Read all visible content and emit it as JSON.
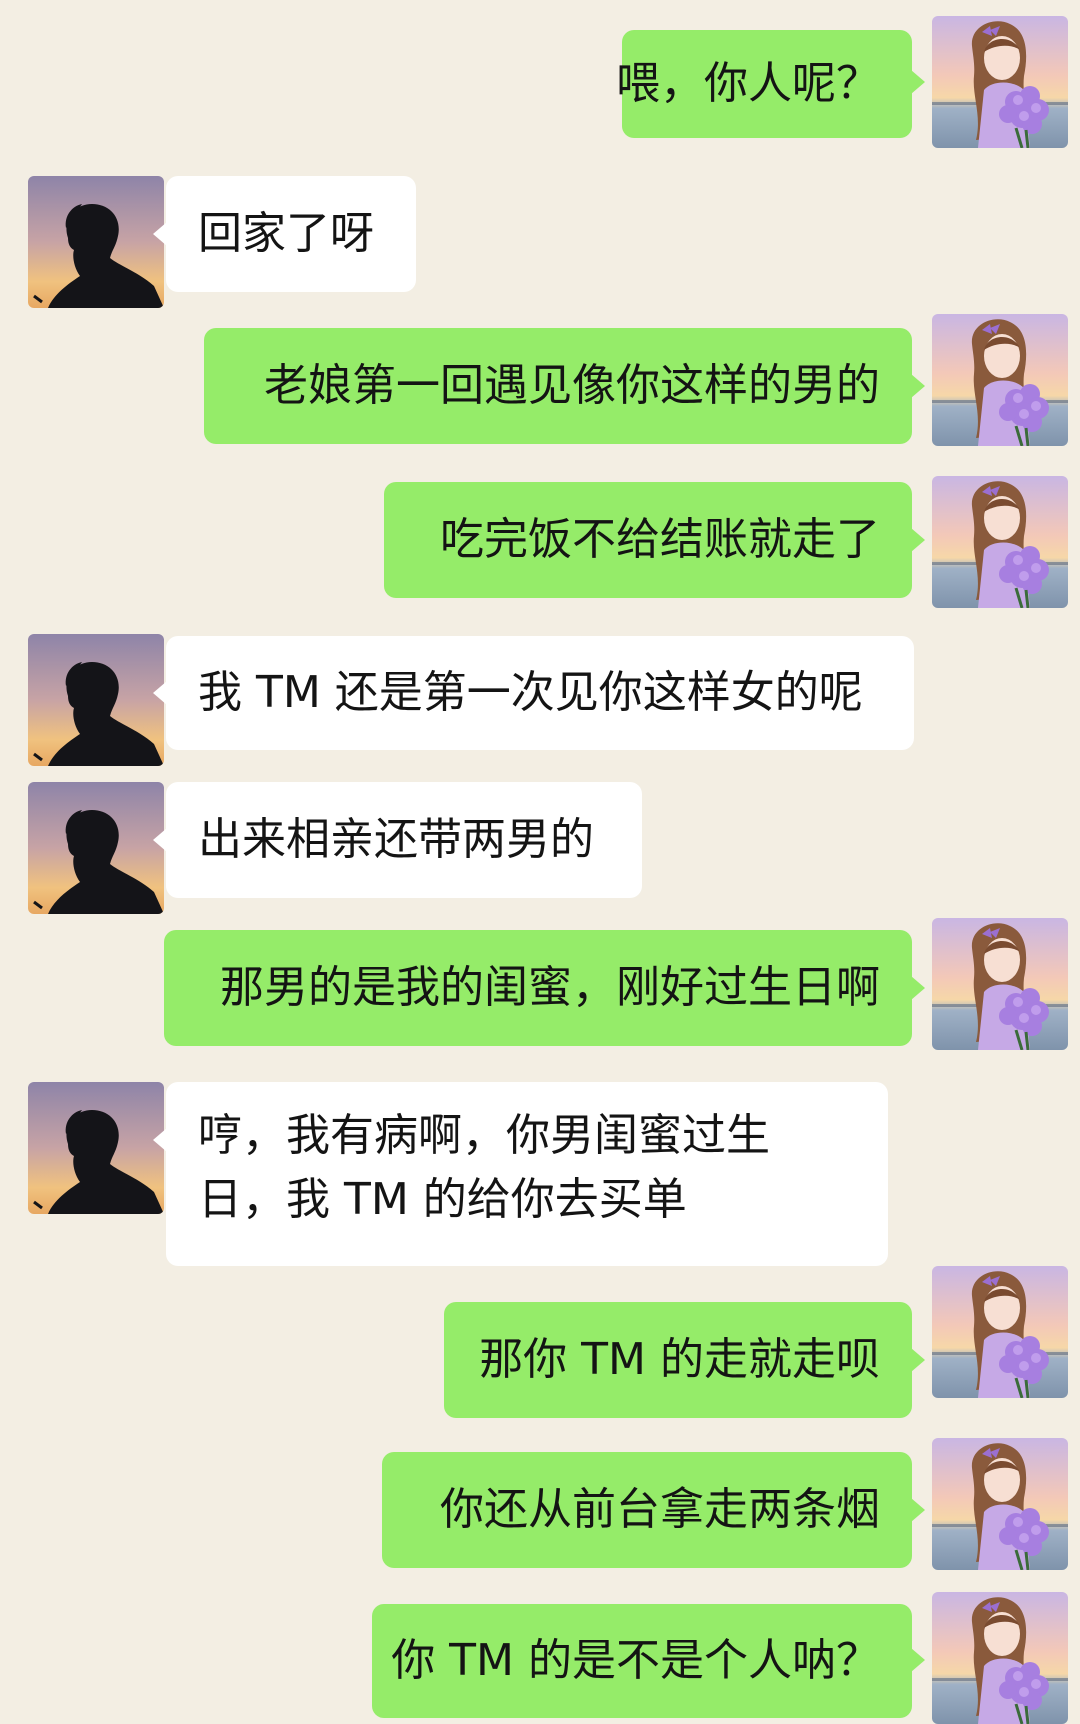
{
  "messages": [
    {
      "side": "sent",
      "text": "喂，你人呢？",
      "avatar": "girl-with-flowers-avatar"
    },
    {
      "side": "recv",
      "text": "回家了呀",
      "avatar": "man-silhouette-avatar"
    },
    {
      "side": "sent",
      "text": "老娘第一回遇见像你这样的男的",
      "avatar": "girl-with-flowers-avatar"
    },
    {
      "side": "sent",
      "text": "吃完饭不给结账就走了",
      "avatar": "girl-with-flowers-avatar"
    },
    {
      "side": "recv",
      "text": "我 TM 还是第一次见你这样女的呢",
      "avatar": "man-silhouette-avatar"
    },
    {
      "side": "recv",
      "text": "出来相亲还带两男的",
      "avatar": "man-silhouette-avatar"
    },
    {
      "side": "sent",
      "text": "那男的是我的闺蜜，刚好过生日啊",
      "avatar": "girl-with-flowers-avatar"
    },
    {
      "side": "recv",
      "text": "哼，我有病啊，你男闺蜜过生日，我 TM 的给你去买单",
      "avatar": "man-silhouette-avatar"
    },
    {
      "side": "sent",
      "text": "那你 TM 的走就走呗",
      "avatar": "girl-with-flowers-avatar"
    },
    {
      "side": "sent",
      "text": "你还从前台拿走两条烟",
      "avatar": "girl-with-flowers-avatar"
    },
    {
      "side": "sent",
      "text": "你 TM 的是不是个人呐？",
      "avatar": "girl-with-flowers-avatar"
    }
  ],
  "colors": {
    "background": "#f3eee3",
    "sent_bubble": "#95ec69",
    "received_bubble": "#ffffff",
    "text": "#141414"
  }
}
